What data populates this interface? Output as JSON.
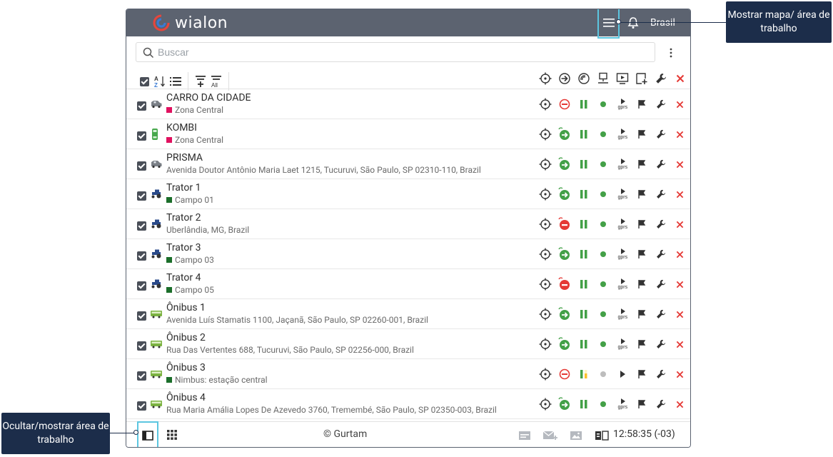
{
  "header": {
    "logo_text": "wialon",
    "region_label": "Brasil"
  },
  "search": {
    "placeholder": "Buscar"
  },
  "units": [
    {
      "name": "CARRO DA CIDADE",
      "sub": "Zona Central",
      "sub_type": "zone",
      "sub_color": "#e0115f",
      "icon": "car-icon"
    },
    {
      "name": "KOMBI",
      "sub": "Zona Central",
      "sub_type": "zone",
      "sub_color": "#e0115f",
      "icon": "van-icon"
    },
    {
      "name": "PRISMA",
      "sub": "Avenida Doutor Antônio Maria Laet 1215, Tucuruvi, São Paulo, SP 02310-110, Brazil",
      "sub_type": "address",
      "icon": "car-icon"
    },
    {
      "name": "Trator 1",
      "sub": "Campo 01",
      "sub_type": "zone",
      "sub_color": "#1b6e2a",
      "icon": "tractor-icon"
    },
    {
      "name": "Trator 2",
      "sub": "Uberlândia, MG, Brazil",
      "sub_type": "address",
      "icon": "tractor-icon"
    },
    {
      "name": "Trator 3",
      "sub": "Campo 03",
      "sub_type": "zone",
      "sub_color": "#1b6e2a",
      "icon": "tractor-icon"
    },
    {
      "name": "Trator 4",
      "sub": "Campo 05",
      "sub_type": "zone",
      "sub_color": "#1b6e2a",
      "icon": "tractor-icon"
    },
    {
      "name": "Ônibus 1",
      "sub": "Avenida Luís Stamatis 1100, Jaçanã, São Paulo, SP 02260-001, Brazil",
      "sub_type": "address",
      "icon": "bus-icon"
    },
    {
      "name": "Ônibus 2",
      "sub": "Rua Das Vertentes 688, Tucuruvi, São Paulo, SP 02256-000, Brazil",
      "sub_type": "address",
      "icon": "bus-icon"
    },
    {
      "name": "Ônibus 3",
      "sub": "Nimbus: estação central",
      "sub_type": "zone",
      "sub_color": "#1b6e2a",
      "icon": "bus-icon"
    },
    {
      "name": "Ônibus 4",
      "sub": "Rua Maria Amália Lopes De Azevedo 3760, Tremembé, São Paulo, SP 02350-003, Brazil",
      "sub_type": "address",
      "icon": "bus-icon"
    }
  ],
  "footer": {
    "copyright": "© Gurtam",
    "clock": "12:58:35 (-03)"
  },
  "callouts": {
    "top": "Mostrar mapa/ área de trabalho",
    "bottom": "Ocultar/mostrar área de trabalho"
  }
}
